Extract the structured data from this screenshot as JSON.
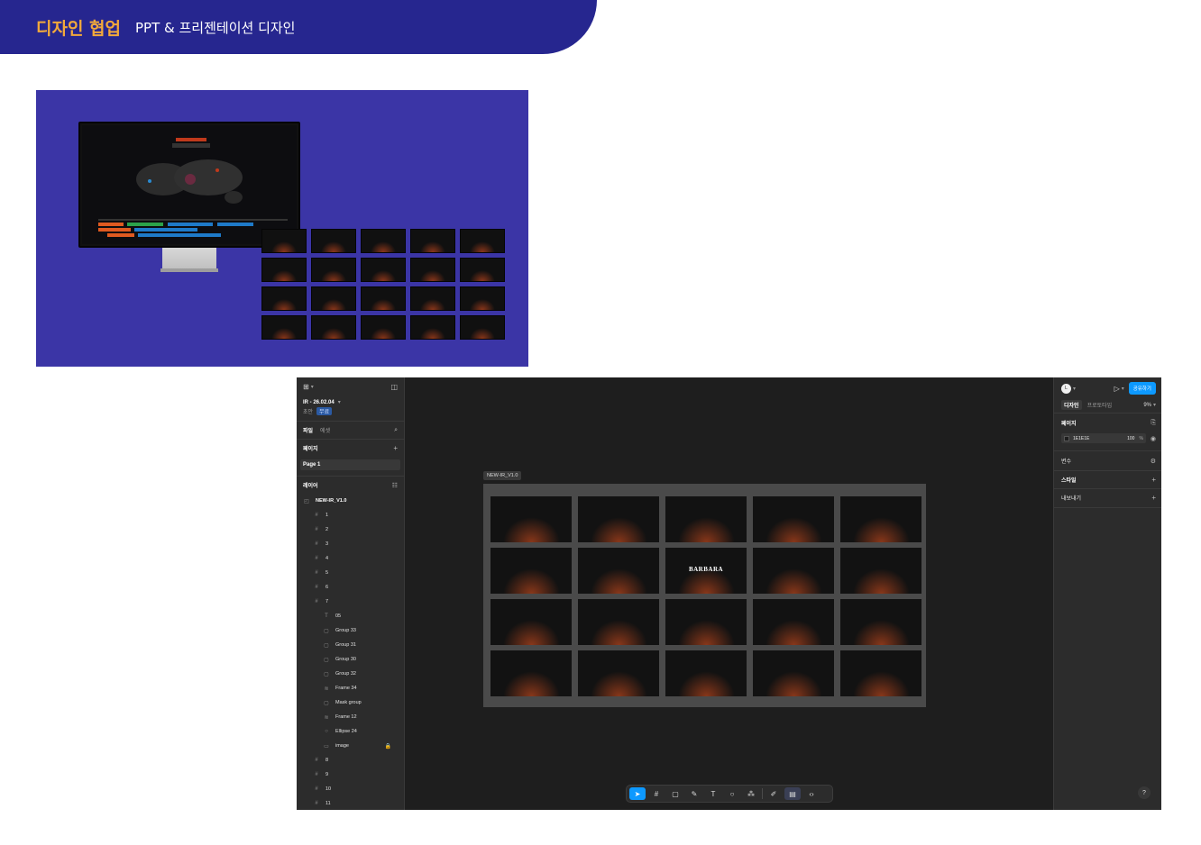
{
  "header": {
    "title_main": "디자인 협업",
    "title_sub": "PPT & 프리젠테이션 디자인"
  },
  "colors": {
    "banner": "#26268f",
    "accent": "#f2a93b",
    "showcase_bg": "#3b35a6",
    "figma_blue": "#0d99ff"
  },
  "figma": {
    "file_name": "IR - 26.02.04",
    "draft": "초안",
    "plan": "무료",
    "tabs": {
      "file": "파일",
      "assets": "에셋"
    },
    "pages_label": "페이지",
    "page_item": "Page 1",
    "layers_label": "레이어",
    "root_frame": "NEW-IR_V1.0",
    "layers": [
      {
        "label": "1",
        "icon": "#",
        "depth": 1
      },
      {
        "label": "2",
        "icon": "#",
        "depth": 1
      },
      {
        "label": "3",
        "icon": "#",
        "depth": 1
      },
      {
        "label": "4",
        "icon": "#",
        "depth": 1
      },
      {
        "label": "5",
        "icon": "#",
        "depth": 1
      },
      {
        "label": "6",
        "icon": "#",
        "depth": 1
      },
      {
        "label": "7",
        "icon": "#",
        "depth": 1
      },
      {
        "label": "05",
        "icon": "T",
        "depth": 2
      },
      {
        "label": "Group 33",
        "icon": "▢",
        "depth": 2
      },
      {
        "label": "Group 31",
        "icon": "▢",
        "depth": 2
      },
      {
        "label": "Group 30",
        "icon": "▢",
        "depth": 2
      },
      {
        "label": "Group 32",
        "icon": "▢",
        "depth": 2
      },
      {
        "label": "Frame 34",
        "icon": "≋",
        "depth": 2
      },
      {
        "label": "Mask group",
        "icon": "▢",
        "depth": 2
      },
      {
        "label": "Frame 12",
        "icon": "≋",
        "depth": 2
      },
      {
        "label": "Ellipse 24",
        "icon": "○",
        "depth": 2
      },
      {
        "label": "image",
        "icon": "▭",
        "depth": 2
      },
      {
        "label": "8",
        "icon": "#",
        "depth": 1
      },
      {
        "label": "9",
        "icon": "#",
        "depth": 1
      },
      {
        "label": "10",
        "icon": "#",
        "depth": 1
      },
      {
        "label": "11",
        "icon": "#",
        "depth": 1
      }
    ],
    "frame_label": "NEW-IR_V1.0",
    "slide_title": "BARBARA",
    "right": {
      "avatar": "L",
      "share": "공유하기",
      "tab_design": "디자인",
      "tab_prototype": "프로토타입",
      "zoom": "9%",
      "page_section": "페이지",
      "bg_hex": "1E1E1E",
      "bg_opacity": "100",
      "bg_pct": "%",
      "variables": "변수",
      "styles": "스타일",
      "export": "내보내기"
    },
    "help": "?"
  }
}
